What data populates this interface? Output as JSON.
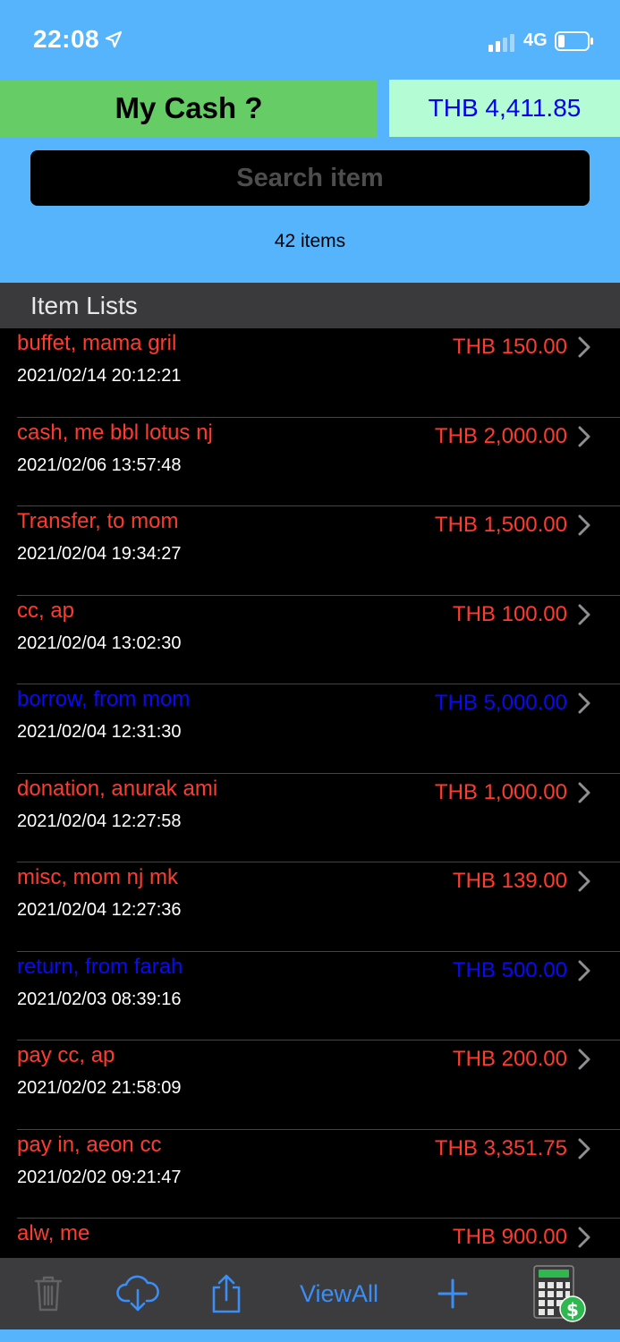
{
  "status": {
    "time": "22:08",
    "network": "4G"
  },
  "header": {
    "title": "My Cash ?",
    "balance": "THB 4,411.85"
  },
  "search": {
    "placeholder": "Search item"
  },
  "summary": {
    "count": "42 items"
  },
  "section": {
    "title": "Item Lists"
  },
  "items": [
    {
      "name": "buffet, mama gril",
      "date": "2021/02/14 20:12:21",
      "amount": "THB 150.00",
      "type": "expense"
    },
    {
      "name": "cash, me bbl lotus nj",
      "date": "2021/02/06 13:57:48",
      "amount": "THB 2,000.00",
      "type": "expense"
    },
    {
      "name": "Transfer, to mom",
      "date": "2021/02/04 19:34:27",
      "amount": "THB 1,500.00",
      "type": "expense"
    },
    {
      "name": "cc, ap",
      "date": "2021/02/04 13:02:30",
      "amount": "THB 100.00",
      "type": "expense"
    },
    {
      "name": "borrow, from mom",
      "date": "2021/02/04 12:31:30",
      "amount": "THB 5,000.00",
      "type": "income"
    },
    {
      "name": "donation, anurak ami",
      "date": "2021/02/04 12:27:58",
      "amount": "THB 1,000.00",
      "type": "expense"
    },
    {
      "name": "misc, mom nj mk",
      "date": "2021/02/04 12:27:36",
      "amount": "THB 139.00",
      "type": "expense"
    },
    {
      "name": "return, from farah",
      "date": "2021/02/03 08:39:16",
      "amount": "THB 500.00",
      "type": "income"
    },
    {
      "name": "pay cc, ap",
      "date": "2021/02/02 21:58:09",
      "amount": "THB 200.00",
      "type": "expense"
    },
    {
      "name": "pay in, aeon cc",
      "date": "2021/02/02 09:21:47",
      "amount": "THB 3,351.75",
      "type": "expense"
    },
    {
      "name": "alw, me",
      "date": "",
      "amount": "THB 900.00",
      "type": "expense"
    }
  ],
  "toolbar": {
    "view_all_label": "ViewAll"
  },
  "colors": {
    "expense": "#ff3b30",
    "income": "#0a0af5",
    "accent": "#3a8ef6",
    "background": "#55b4fb"
  }
}
